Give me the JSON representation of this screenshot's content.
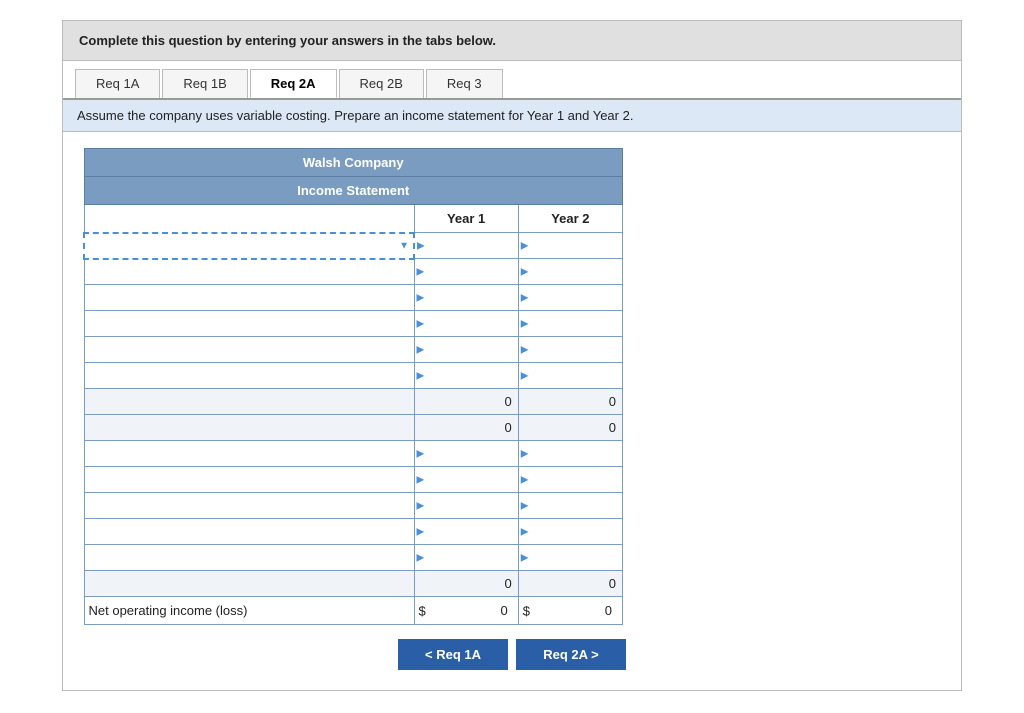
{
  "instruction": "Complete this question by entering your answers in the tabs below.",
  "tabs": [
    {
      "id": "req1a",
      "label": "Req 1A",
      "active": false
    },
    {
      "id": "req1b",
      "label": "Req 1B",
      "active": false
    },
    {
      "id": "req2a",
      "label": "Req 2A",
      "active": true
    },
    {
      "id": "req2b",
      "label": "Req 2B",
      "active": false
    },
    {
      "id": "req3",
      "label": "Req 3",
      "active": false
    }
  ],
  "sub_instruction": "Assume the company uses variable costing. Prepare an income statement for Year 1 and Year 2.",
  "table": {
    "company_name": "Walsh Company",
    "statement_title": "Income Statement",
    "col_year1": "Year 1",
    "col_year2": "Year 2",
    "rows": [
      {
        "type": "dropdown",
        "label": "",
        "year1": "",
        "year2": ""
      },
      {
        "type": "input",
        "label": "",
        "year1": "",
        "year2": ""
      },
      {
        "type": "input",
        "label": "",
        "year1": "",
        "year2": ""
      },
      {
        "type": "input",
        "label": "",
        "year1": "",
        "year2": ""
      },
      {
        "type": "input",
        "label": "",
        "year1": "",
        "year2": ""
      },
      {
        "type": "input",
        "label": "",
        "year1": "",
        "year2": ""
      },
      {
        "type": "total",
        "label": "",
        "year1": "0",
        "year2": "0"
      },
      {
        "type": "total",
        "label": "",
        "year1": "0",
        "year2": "0"
      },
      {
        "type": "input",
        "label": "",
        "year1": "",
        "year2": ""
      },
      {
        "type": "input",
        "label": "",
        "year1": "",
        "year2": ""
      },
      {
        "type": "input",
        "label": "",
        "year1": "",
        "year2": ""
      },
      {
        "type": "input",
        "label": "",
        "year1": "",
        "year2": ""
      },
      {
        "type": "input",
        "label": "",
        "year1": "",
        "year2": ""
      },
      {
        "type": "total",
        "label": "",
        "year1": "0",
        "year2": "0"
      }
    ],
    "net_income_label": "Net operating income (loss)",
    "net_income_year1": "0",
    "net_income_year2": "0"
  },
  "buttons": {
    "prev_label": "< Req 1A",
    "next_label": "Req 2A >"
  }
}
